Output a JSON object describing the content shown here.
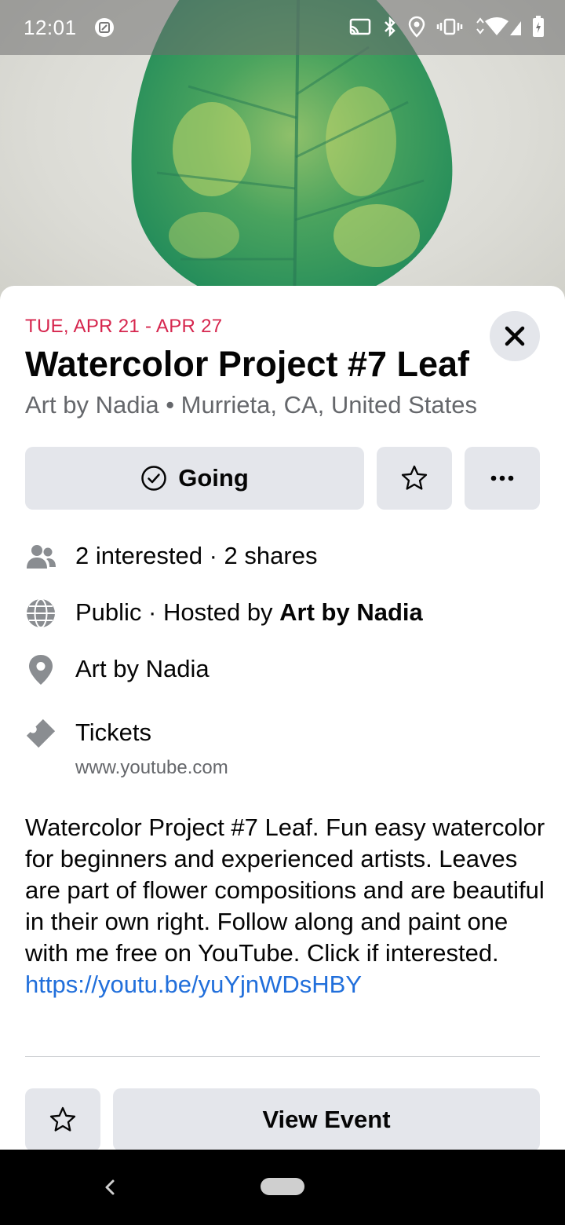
{
  "status_bar": {
    "time": "12:01"
  },
  "event": {
    "date": "TUE, APR 21 - APR 27",
    "title": "Watercolor Project #7 Leaf",
    "subtitle": "Art by Nadia • Murrieta, CA, United States"
  },
  "actions": {
    "going_label": "Going"
  },
  "details": {
    "interested": "2 interested · 2 shares",
    "privacy_prefix": "Public · Hosted by ",
    "host": "Art by Nadia",
    "location": "Art by Nadia",
    "tickets_label": "Tickets",
    "tickets_url": "www.youtube.com"
  },
  "description": {
    "text": "Watercolor Project #7 Leaf. Fun easy watercolor for beginners and experienced artists. Leaves are part of flower compositions and are beautiful in their own right. Follow along and paint one with me free on YouTube. Click if interested.",
    "link": "https://youtu.be/yuYjnWDsHBY"
  },
  "footer": {
    "view_event_label": "View Event"
  },
  "colors": {
    "date_accent": "#d6264e",
    "link": "#216fdb",
    "button_bg": "#e4e6eb",
    "secondary_text": "#65676b"
  },
  "icons": {
    "going": "check-circle-icon",
    "save": "star-icon",
    "more": "more-dots-icon",
    "close": "close-icon",
    "interested": "people-icon",
    "privacy": "globe-icon",
    "location": "location-pin-icon",
    "tickets": "ticket-icon"
  }
}
